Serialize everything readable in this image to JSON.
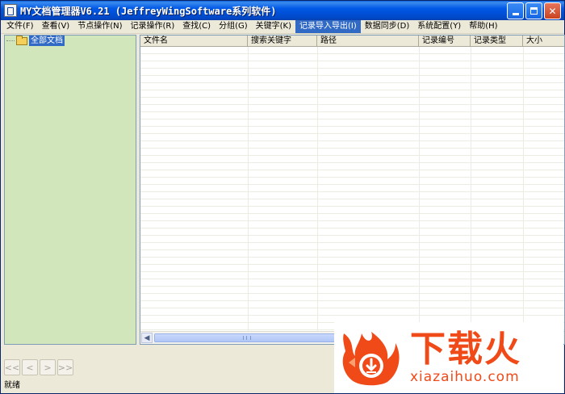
{
  "window": {
    "title": "MY文档管理器V6.21 (JeffreyWingSoftware系列软件)"
  },
  "menu": {
    "items": [
      "文件(F)",
      "查看(V)",
      "节点操作(N)",
      "记录操作(R)",
      "查找(C)",
      "分组(G)",
      "关键字(K)",
      "记录导入导出(I)",
      "数据同步(D)",
      "系统配置(Y)",
      "帮助(H)"
    ],
    "active_index": 7
  },
  "tree": {
    "root_label": "全部文档"
  },
  "list": {
    "columns": [
      "文件名",
      "搜索关键字",
      "路径",
      "记录编号",
      "记录类型",
      "大小"
    ]
  },
  "nav": {
    "first": "<<",
    "prev": "<",
    "next": ">",
    "last": ">>"
  },
  "status": {
    "text": "就绪"
  },
  "watermark": {
    "brand_cn": "下载火",
    "brand_url": "xiazaihuo.com",
    "accent": "#EF4A18"
  }
}
